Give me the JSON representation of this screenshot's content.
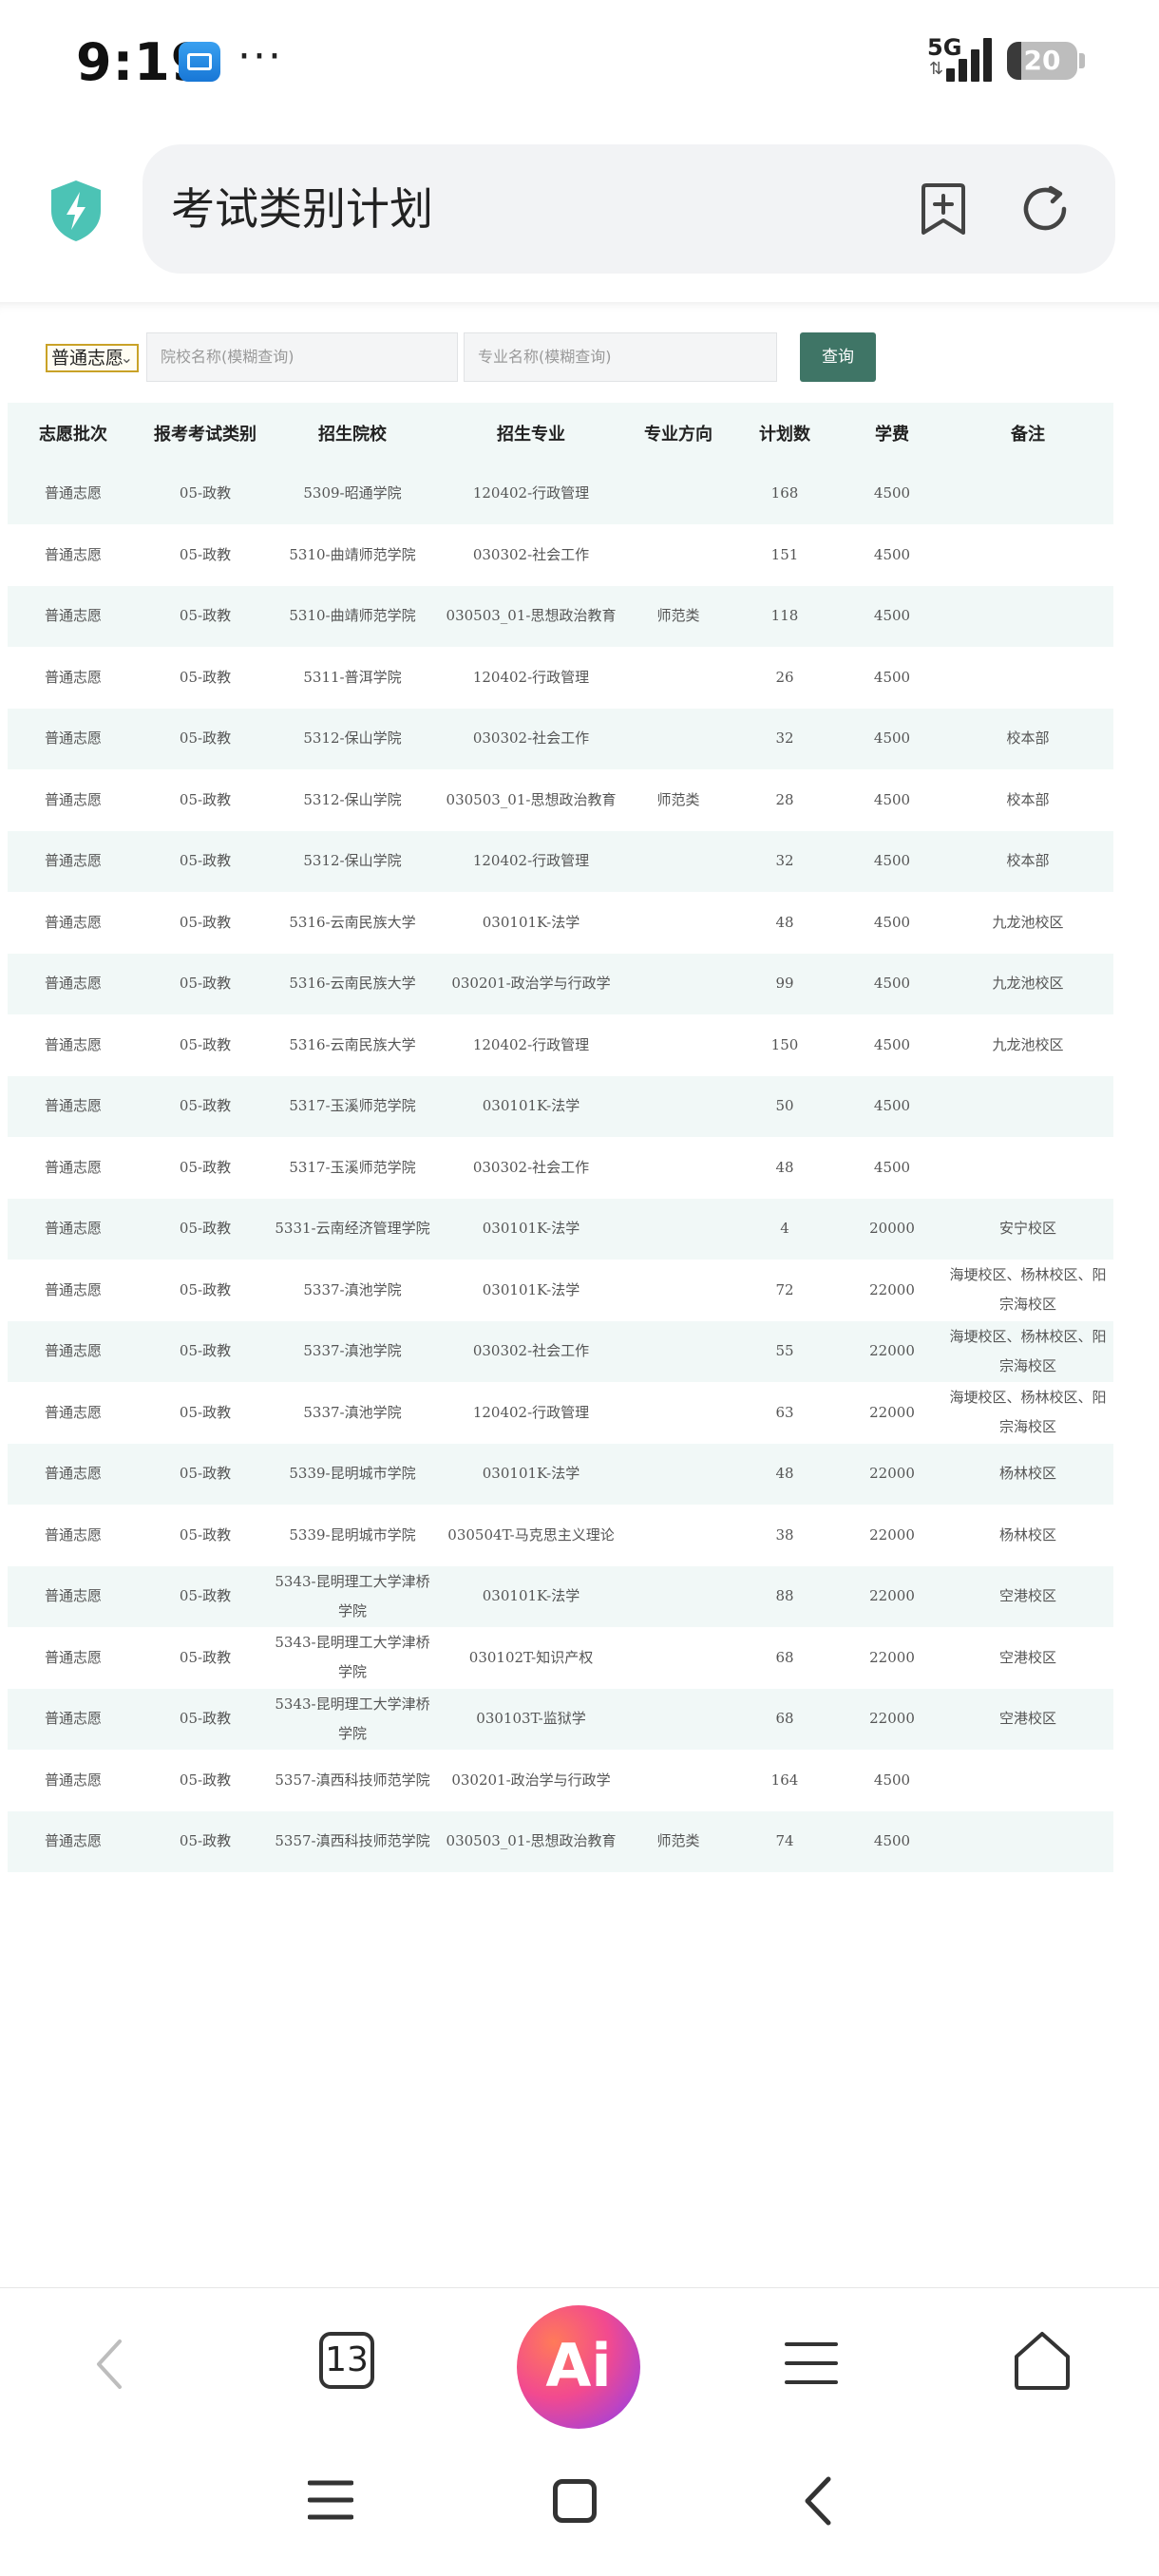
{
  "status_bar": {
    "time": "9:19",
    "dots": "···",
    "network": "5G",
    "signal_arrows": "⇅",
    "battery_level": "20",
    "battery_fraction": 0.2
  },
  "browser": {
    "address_title": "考试类别计划"
  },
  "filters": {
    "batch_select_value": "普通志愿",
    "school_placeholder": "院校名称(模糊查询)",
    "major_placeholder": "专业名称(模糊查询)",
    "query_label": "查询"
  },
  "table": {
    "columns": [
      "志愿批次",
      "报考考试类别",
      "招生院校",
      "招生专业",
      "专业方向",
      "计划数",
      "学费",
      "备注"
    ],
    "rows": [
      [
        "普通志愿",
        "05-政教",
        "5309-昭通学院",
        "120402-行政管理",
        "",
        "168",
        "4500",
        ""
      ],
      [
        "普通志愿",
        "05-政教",
        "5310-曲靖师范学院",
        "030302-社会工作",
        "",
        "151",
        "4500",
        ""
      ],
      [
        "普通志愿",
        "05-政教",
        "5310-曲靖师范学院",
        "030503_01-思想政治教育",
        "师范类",
        "118",
        "4500",
        ""
      ],
      [
        "普通志愿",
        "05-政教",
        "5311-普洱学院",
        "120402-行政管理",
        "",
        "26",
        "4500",
        ""
      ],
      [
        "普通志愿",
        "05-政教",
        "5312-保山学院",
        "030302-社会工作",
        "",
        "32",
        "4500",
        "校本部"
      ],
      [
        "普通志愿",
        "05-政教",
        "5312-保山学院",
        "030503_01-思想政治教育",
        "师范类",
        "28",
        "4500",
        "校本部"
      ],
      [
        "普通志愿",
        "05-政教",
        "5312-保山学院",
        "120402-行政管理",
        "",
        "32",
        "4500",
        "校本部"
      ],
      [
        "普通志愿",
        "05-政教",
        "5316-云南民族大学",
        "030101K-法学",
        "",
        "48",
        "4500",
        "九龙池校区"
      ],
      [
        "普通志愿",
        "05-政教",
        "5316-云南民族大学",
        "030201-政治学与行政学",
        "",
        "99",
        "4500",
        "九龙池校区"
      ],
      [
        "普通志愿",
        "05-政教",
        "5316-云南民族大学",
        "120402-行政管理",
        "",
        "150",
        "4500",
        "九龙池校区"
      ],
      [
        "普通志愿",
        "05-政教",
        "5317-玉溪师范学院",
        "030101K-法学",
        "",
        "50",
        "4500",
        ""
      ],
      [
        "普通志愿",
        "05-政教",
        "5317-玉溪师范学院",
        "030302-社会工作",
        "",
        "48",
        "4500",
        ""
      ],
      [
        "普通志愿",
        "05-政教",
        "5331-云南经济管理学院",
        "030101K-法学",
        "",
        "4",
        "20000",
        "安宁校区"
      ],
      [
        "普通志愿",
        "05-政教",
        "5337-滇池学院",
        "030101K-法学",
        "",
        "72",
        "22000",
        "海埂校区、杨林校区、阳宗海校区"
      ],
      [
        "普通志愿",
        "05-政教",
        "5337-滇池学院",
        "030302-社会工作",
        "",
        "55",
        "22000",
        "海埂校区、杨林校区、阳宗海校区"
      ],
      [
        "普通志愿",
        "05-政教",
        "5337-滇池学院",
        "120402-行政管理",
        "",
        "63",
        "22000",
        "海埂校区、杨林校区、阳宗海校区"
      ],
      [
        "普通志愿",
        "05-政教",
        "5339-昆明城市学院",
        "030101K-法学",
        "",
        "48",
        "22000",
        "杨林校区"
      ],
      [
        "普通志愿",
        "05-政教",
        "5339-昆明城市学院",
        "030504T-马克思主义理论",
        "",
        "38",
        "22000",
        "杨林校区"
      ],
      [
        "普通志愿",
        "05-政教",
        "5343-昆明理工大学津桥学院",
        "030101K-法学",
        "",
        "88",
        "22000",
        "空港校区"
      ],
      [
        "普通志愿",
        "05-政教",
        "5343-昆明理工大学津桥学院",
        "030102T-知识产权",
        "",
        "68",
        "22000",
        "空港校区"
      ],
      [
        "普通志愿",
        "05-政教",
        "5343-昆明理工大学津桥学院",
        "030103T-监狱学",
        "",
        "68",
        "22000",
        "空港校区"
      ],
      [
        "普通志愿",
        "05-政教",
        "5357-滇西科技师范学院",
        "030201-政治学与行政学",
        "",
        "164",
        "4500",
        ""
      ],
      [
        "普通志愿",
        "05-政教",
        "5357-滇西科技师范学院",
        "030503_01-思想政治教育",
        "师范类",
        "74",
        "4500",
        ""
      ]
    ]
  },
  "bottom_toolbar": {
    "tab_count": "13",
    "ai_label": "Ai"
  },
  "colors": {
    "accent": "#3f7566",
    "row_tint": "#f1f8f7",
    "select_border": "#c9a227",
    "shield": "#4cc3b5"
  }
}
